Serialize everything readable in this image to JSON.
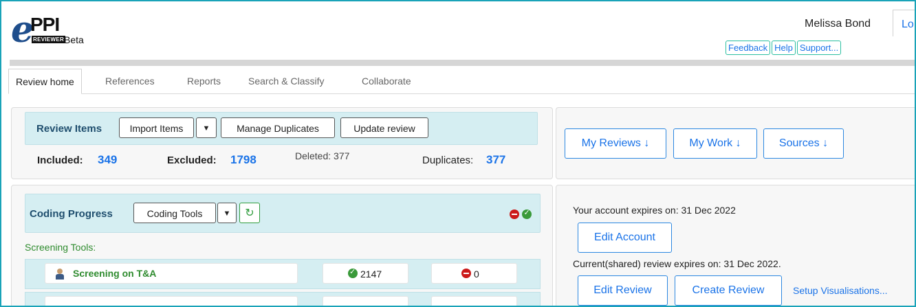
{
  "header": {
    "logo_e": "e",
    "logo_ppi": "PPI",
    "logo_reviewer": "REVIEWER",
    "logo_beta": "Beta",
    "user_name": "Melissa Bond",
    "logout_partial": "Lo",
    "links": [
      "Feedback",
      "Help",
      "Support..."
    ]
  },
  "tabs": [
    "Review home",
    "References",
    "Reports",
    "Search & Classify",
    "Collaborate"
  ],
  "review_items": {
    "title": "Review Items",
    "import_label": "Import Items",
    "dropdown_glyph": "▼",
    "manage_duplicates": "Manage Duplicates",
    "update_review": "Update review",
    "included_label": "Included:",
    "included_value": "349",
    "excluded_label": "Excluded:",
    "excluded_value": "1798",
    "deleted_text": "Deleted: 377",
    "duplicates_label": "Duplicates:",
    "duplicates_value": "377"
  },
  "nav_buttons": {
    "my_reviews": "My Reviews ↓",
    "my_work": "My Work ↓",
    "sources": "Sources ↓"
  },
  "coding": {
    "title": "Coding Progress",
    "tools_label": "Coding Tools",
    "dropdown_glyph": "▼",
    "refresh_glyph": "↻",
    "screening_tools_label": "Screening Tools:",
    "rows": [
      {
        "name": "Screening on T&A",
        "included": "2147",
        "excluded": "0"
      }
    ]
  },
  "account": {
    "expires_text": "Your account expires on: 31 Dec 2022",
    "edit_account": "Edit Account",
    "review_expires_text": "Current(shared) review expires on: 31 Dec 2022.",
    "edit_review": "Edit Review",
    "create_review": "Create Review",
    "setup_visualisations": "Setup Visualisations..."
  },
  "colors": {
    "frame_border": "#19a3b8",
    "teal_bar": "#d5eef2",
    "link_blue": "#1a73e8",
    "green_text": "#2e8b2e"
  }
}
